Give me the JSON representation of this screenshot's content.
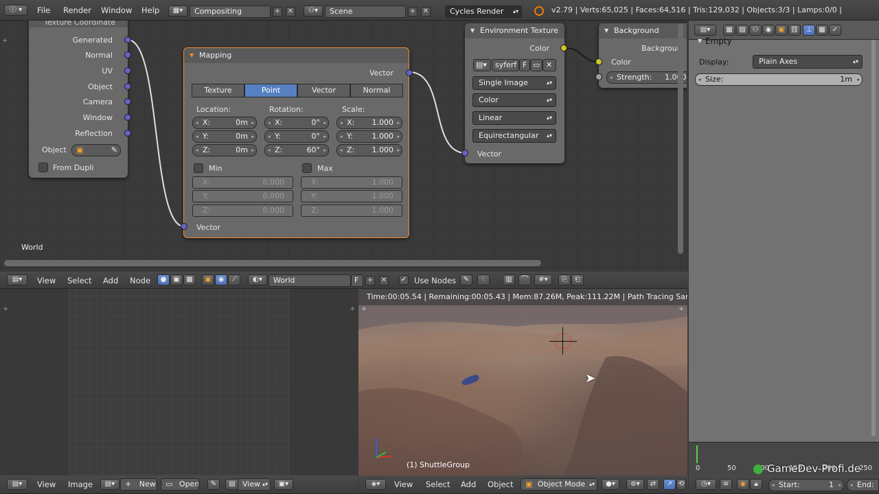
{
  "topbar": {
    "menus": [
      "File",
      "Render",
      "Window",
      "Help"
    ],
    "screen_layout": "Compositing",
    "scene": "Scene",
    "engine": "Cycles Render",
    "stats": "v2.79 | Verts:65,025 | Faces:64,516 | Tris:129,032 | Objects:3/3 | Lamps:0/0 | Mem:218.60M"
  },
  "node_editor": {
    "tex_coord": {
      "title": "Texture Coordinate",
      "outputs": [
        "Generated",
        "Normal",
        "UV",
        "Object",
        "Camera",
        "Window",
        "Reflection"
      ],
      "object_label": "Object",
      "from_dupli": "From Dupli"
    },
    "mapping": {
      "title": "Mapping",
      "output": "Vector",
      "tabs": [
        "Texture",
        "Point",
        "Vector",
        "Normal"
      ],
      "selected_tab": "Point",
      "location_label": "Location:",
      "rotation_label": "Rotation:",
      "scale_label": "Scale:",
      "location": [
        "0m",
        "0m",
        "0m"
      ],
      "rotation": [
        "0°",
        "0°",
        "60°"
      ],
      "scale": [
        "1.000",
        "1.000",
        "1.000"
      ],
      "axes": [
        "X:",
        "Y:",
        "Z:"
      ],
      "min_label": "Min",
      "max_label": "Max",
      "min": [
        "0.000",
        "0.000",
        "0.000"
      ],
      "max": [
        "1.000",
        "1.000",
        "1.000"
      ],
      "input": "Vector"
    },
    "env_texture": {
      "title": "Environment Texture",
      "output": "Color",
      "image_name": "syferf",
      "fake_user": "F",
      "projection": "Single Image",
      "color": "Color",
      "interpolation": "Linear",
      "mapping": "Equirectangular",
      "input": "Vector"
    },
    "background": {
      "title": "Background",
      "output": "Backgroun",
      "color": "Color",
      "strength_label": "Strength:",
      "strength": "1.000"
    },
    "context_label": "World"
  },
  "node_header": {
    "menus": [
      "View",
      "Select",
      "Add",
      "Node"
    ],
    "world_name": "World",
    "fake_user": "F",
    "use_nodes": "Use Nodes"
  },
  "properties": {
    "panel_title": "Empty",
    "display_label": "Display:",
    "display_value": "Plain Axes",
    "size_label": "Size:",
    "size_value": "1m"
  },
  "viewport": {
    "render_info": "Time:00:05.54 | Remaining:00:05.43 | Mem:87.26M, Peak:111.22M | Path Tracing Sample 1",
    "object_label": "(1) ShuttleGroup"
  },
  "image_header": {
    "menus": [
      "View",
      "Image"
    ],
    "new_label": "New",
    "open_label": "Open",
    "view_label": "View"
  },
  "view3d_header": {
    "menus": [
      "View",
      "Select",
      "Add",
      "Object"
    ],
    "mode": "Object Mode"
  },
  "timeline": {
    "ticks": [
      "0",
      "50",
      "100",
      "150",
      "200",
      "250"
    ],
    "start_label": "Start:",
    "start_value": "1",
    "end_label": "End:",
    "watermark": "GameDev-Profi.de"
  }
}
